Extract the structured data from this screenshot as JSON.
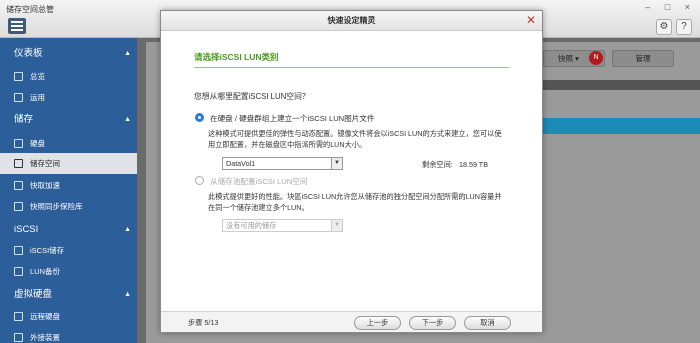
{
  "app": {
    "title": "储存空间总管",
    "window_controls": "– □ ×"
  },
  "sidebar": {
    "sections": [
      {
        "label": "仪表板",
        "items": [
          "总览",
          "运用"
        ]
      },
      {
        "label": "储存",
        "items": [
          "硬盘",
          "储存空间",
          "快取加速",
          "快照同步保险库"
        ]
      },
      {
        "label": "iSCSI",
        "items": [
          "iSCSI储存",
          "LUN备份"
        ]
      },
      {
        "label": "虚拟硬盘",
        "items": [
          "远程硬盘",
          "外接装置"
        ]
      }
    ],
    "active_item": "储存空间"
  },
  "background": {
    "snapshot_label": "快照",
    "snapshot_badge": "N",
    "manage_label": "管理"
  },
  "dialog": {
    "title": "快速设定精灵",
    "close_icon": "close-icon",
    "step_title": "请选择iSCSI LUN类别",
    "question": "您想从哪里配置iSCSI LUN空间？",
    "option1": {
      "label": "在硬盘 / 硬盘群组上建立一个iSCSI LUN图片文件",
      "desc_line1": "这种模式可提供更佳的弹性与动态配置。镜像文件将会以iSCSI LUN的方式来建立，您可以使",
      "desc_line2": "用立即配置，并在磁盘区中指派所需的LUN大小。",
      "volume_value": "DataVol1",
      "free_label": "剩余空间:",
      "free_value": "18.59 TB"
    },
    "option2": {
      "label": "从储存池配置iSCSI LUN空间",
      "desc_line1": "此模式提供更好的性能。块區iSCSI LUN允许您从储存池的独分配空间分配所需的LUN容量并",
      "desc_line2": "在同一个储存池建立多个LUN。",
      "pool_value": "没有可用的储存"
    },
    "footer": {
      "step": "步骤 5/13",
      "prev": "上一步",
      "next": "下一步",
      "cancel": "取消"
    }
  }
}
